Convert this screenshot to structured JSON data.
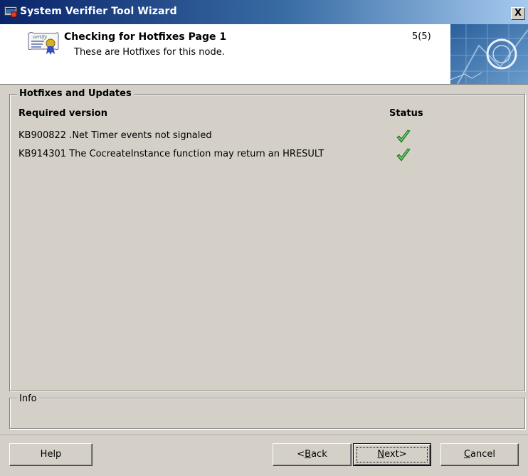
{
  "window": {
    "title": "System Verifier Tool Wizard",
    "close_label": "X"
  },
  "header": {
    "title": "Checking for Hotfixes  Page 1",
    "subtitle": "These are Hotfixes for this node.",
    "step": "5(5)"
  },
  "hotfixes_group": {
    "legend": "Hotfixes and Updates",
    "col_required": "Required version",
    "col_status": "Status",
    "rows": [
      {
        "text": "KB900822 .Net Timer events not signaled",
        "status_icon": "green-check-icon"
      },
      {
        "text": "KB914301 The CocreateInstance function may return an HRESULT",
        "status_icon": "green-check-icon"
      }
    ]
  },
  "info_group": {
    "legend": "Info"
  },
  "buttons": {
    "help": "Help",
    "back_prefix": "<",
    "back_underline": "B",
    "back_rest": "ack",
    "next_underline": "N",
    "next_rest": "ext>",
    "cancel_underline": "C",
    "cancel_rest": "ancel"
  },
  "colors": {
    "face": "#d4d0c8",
    "title_start": "#0a246a",
    "title_end": "#a6caf0",
    "check_green": "#2e9b2e"
  }
}
